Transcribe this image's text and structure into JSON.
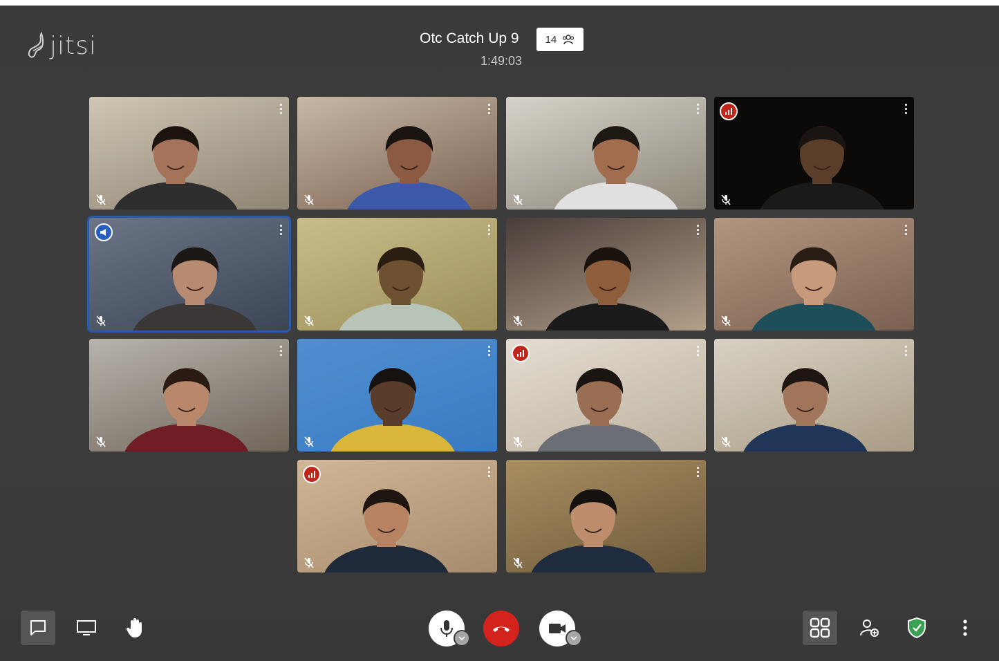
{
  "app": {
    "logo_text": "jitsi"
  },
  "meeting": {
    "title": "Otc Catch Up 9",
    "participant_count": "14",
    "elapsed": "1:49:03"
  },
  "tiles": [
    {
      "id": 1,
      "indicator": "none",
      "active": false,
      "bg": [
        "#cfc6b4",
        "#8f8372"
      ],
      "skin": "#a5735a",
      "hair": "#1c140f",
      "shirt": "#2e2e2e"
    },
    {
      "id": 2,
      "indicator": "none",
      "active": false,
      "bg": [
        "#c7b8a4",
        "#7a6152"
      ],
      "skin": "#8a5b42",
      "hair": "#1a1410",
      "shirt": "#3c58a8"
    },
    {
      "id": 3,
      "indicator": "none",
      "active": false,
      "bg": [
        "#d6d2ca",
        "#8d8779"
      ],
      "skin": "#a26d4f",
      "hair": "#1e1812",
      "shirt": "#e0e0e0"
    },
    {
      "id": 4,
      "indicator": "red",
      "active": false,
      "bg": [
        "#0b0a09",
        "#0b0a09"
      ],
      "skin": "#5a3e2a",
      "hair": "#1a1412",
      "shirt": "#1a1a1a"
    },
    {
      "id": 5,
      "indicator": "blue",
      "active": true,
      "bg": [
        "#6b7585",
        "#3b4556"
      ],
      "skin": "#b78a72",
      "hair": "#1a1714",
      "shirt": "#3a3736"
    },
    {
      "id": 6,
      "indicator": "none",
      "active": false,
      "bg": [
        "#c9bd8a",
        "#9b8e5a"
      ],
      "skin": "#6d5030",
      "hair": "#2a1d12",
      "shirt": "#b8c4b8"
    },
    {
      "id": 7,
      "indicator": "none",
      "active": false,
      "bg": [
        "#4a3e3a",
        "#b3a08a"
      ],
      "skin": "#8e5e3c",
      "hair": "#1a120c",
      "shirt": "#1b1b1b"
    },
    {
      "id": 8,
      "indicator": "none",
      "active": false,
      "bg": [
        "#b39680",
        "#7a6050"
      ],
      "skin": "#c79a7c",
      "hair": "#2a1d16",
      "shirt": "#1e4e5a"
    },
    {
      "id": 9,
      "indicator": "none",
      "active": false,
      "bg": [
        "#b8b3ad",
        "#6f6559"
      ],
      "skin": "#b9876a",
      "hair": "#2a1b14",
      "shirt": "#6e1e24"
    },
    {
      "id": 10,
      "indicator": "none",
      "active": false,
      "bg": [
        "#4f8fd0",
        "#3a7ac2"
      ],
      "skin": "#5a3c2a",
      "hair": "#161210",
      "shirt": "#d9b53a"
    },
    {
      "id": 11,
      "indicator": "red",
      "active": false,
      "bg": [
        "#e4ddd3",
        "#bdb19e"
      ],
      "skin": "#9a6e52",
      "hair": "#1b1511",
      "shirt": "#6b6e74"
    },
    {
      "id": 12,
      "indicator": "none",
      "active": false,
      "bg": [
        "#d8d1c4",
        "#a99c84"
      ],
      "skin": "#a1755a",
      "hair": "#1d1612",
      "shirt": "#1f3658"
    },
    {
      "id": 13,
      "indicator": "red",
      "active": false,
      "bg": [
        "#d0b796",
        "#a78b6d"
      ],
      "skin": "#b78362",
      "hair": "#1c1510",
      "shirt": "#1e2a3a"
    },
    {
      "id": 14,
      "indicator": "none",
      "active": false,
      "bg": [
        "#a98e62",
        "#6d5a3a"
      ],
      "skin": "#bd8d6e",
      "hair": "#15110f",
      "shirt": "#1f2b3f"
    }
  ],
  "toolbar": {
    "left": [
      "chat-icon",
      "screen-share-icon",
      "raise-hand-icon"
    ],
    "center": [
      "microphone-icon",
      "hangup-icon",
      "camera-icon"
    ],
    "right": [
      "tile-view-icon",
      "invite-icon",
      "security-shield-icon",
      "more-icon"
    ]
  },
  "colors": {
    "accent_blue": "#2a5aa8",
    "hangup_red": "#d4221c",
    "shield_green": "#3aa153"
  }
}
